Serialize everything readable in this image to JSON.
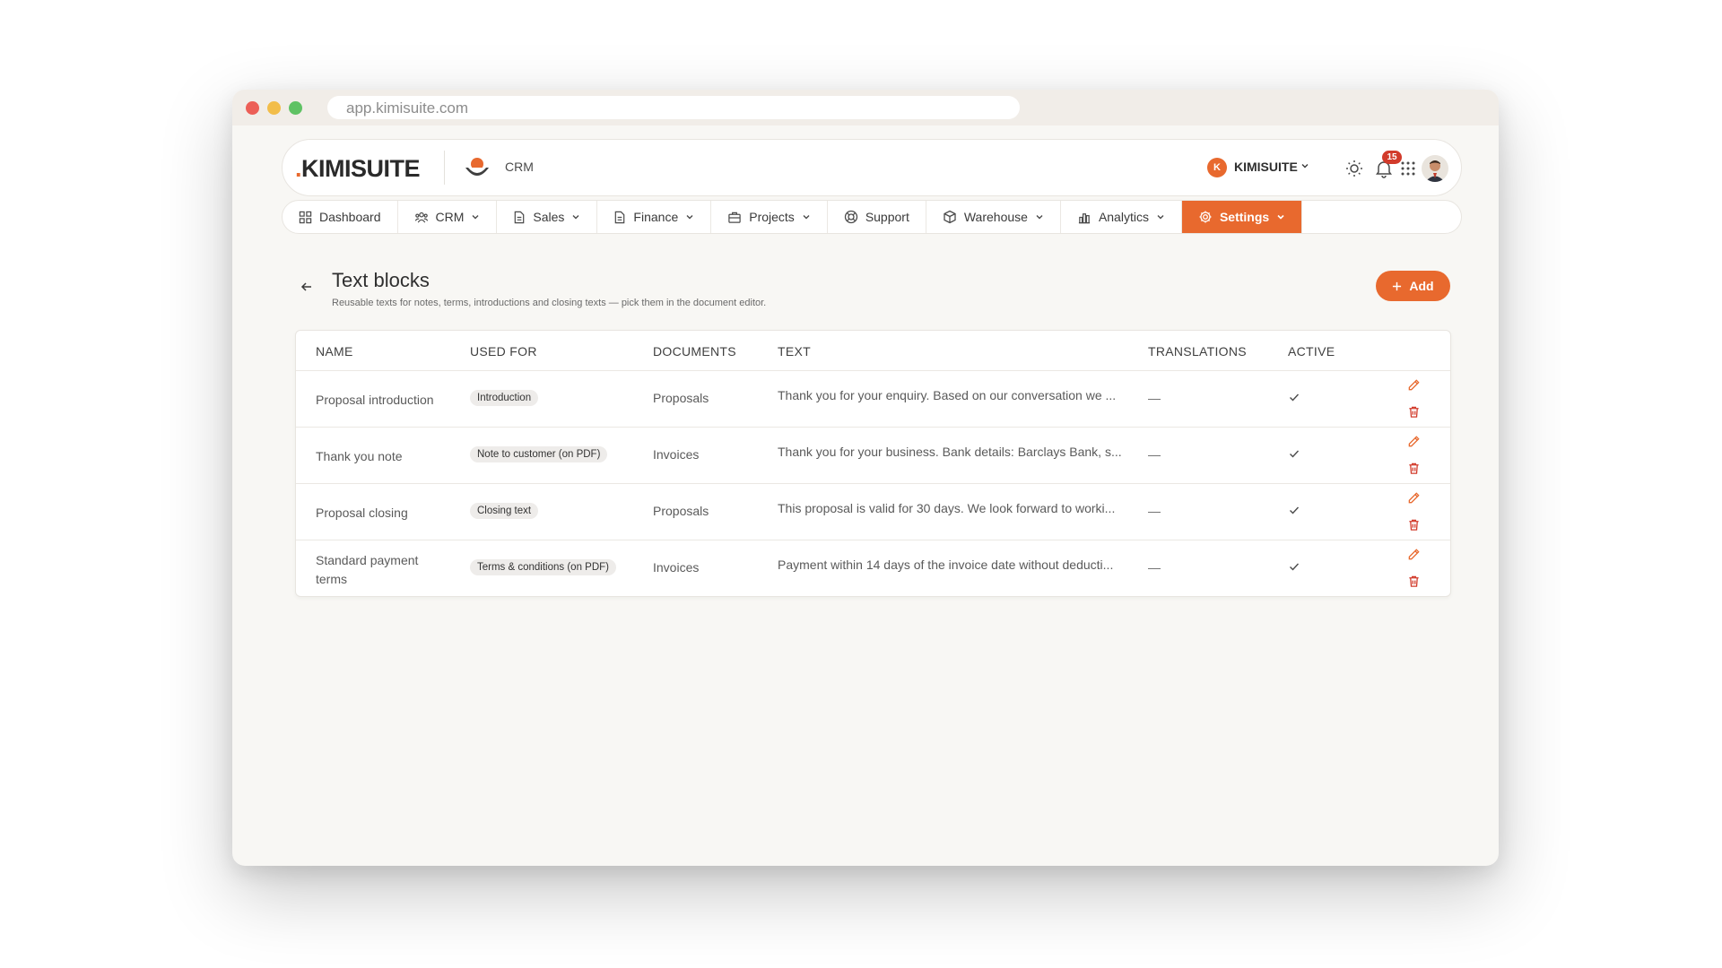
{
  "browser": {
    "url": "app.kimisuite.com"
  },
  "header": {
    "logo_dot": ".",
    "logo_text": "KIMISUITE",
    "app_label": "CRM",
    "org_initial": "K",
    "org_name": "KIMISUITE",
    "notification_count": "15"
  },
  "nav": {
    "items": [
      {
        "label": "Dashboard",
        "icon": "grid-icon"
      },
      {
        "label": "CRM",
        "icon": "users-icon"
      },
      {
        "label": "Sales",
        "icon": "file-icon"
      },
      {
        "label": "Finance",
        "icon": "file-icon"
      },
      {
        "label": "Projects",
        "icon": "briefcase-icon"
      },
      {
        "label": "Support",
        "icon": "lifebuoy-icon"
      },
      {
        "label": "Warehouse",
        "icon": "box-icon"
      },
      {
        "label": "Analytics",
        "icon": "bar-chart-icon"
      },
      {
        "label": "Settings",
        "icon": "gear-icon"
      }
    ],
    "active": "Settings"
  },
  "page": {
    "title": "Text blocks",
    "subtitle": "Reusable texts for notes, terms, introductions and closing texts — pick them in the document editor.",
    "add_label": "Add"
  },
  "table": {
    "headers": [
      "NAME",
      "USED FOR",
      "DOCUMENTS",
      "TEXT",
      "TRANSLATIONS",
      "ACTIVE"
    ],
    "rows": [
      {
        "name": "Proposal introduction",
        "used_for": "Introduction",
        "documents": "Proposals",
        "text": "Thank you for your enquiry. Based on our conversation we ...",
        "translations": "—"
      },
      {
        "name": "Thank you note",
        "used_for": "Note to customer (on PDF)",
        "documents": "Invoices",
        "text": "Thank you for your business. Bank details: Barclays Bank, s...",
        "translations": "—"
      },
      {
        "name": "Proposal closing",
        "used_for": "Closing text",
        "documents": "Proposals",
        "text": "This proposal is valid for 30 days. We look forward to worki...",
        "translations": "—"
      },
      {
        "name": "Standard payment terms",
        "used_for": "Terms & conditions (on PDF)",
        "documents": "Invoices",
        "text": "Payment within 14 days of the invoice date without deducti...",
        "translations": "—"
      }
    ]
  },
  "colors": {
    "accent": "#e8692e",
    "danger": "#d23b2b"
  }
}
